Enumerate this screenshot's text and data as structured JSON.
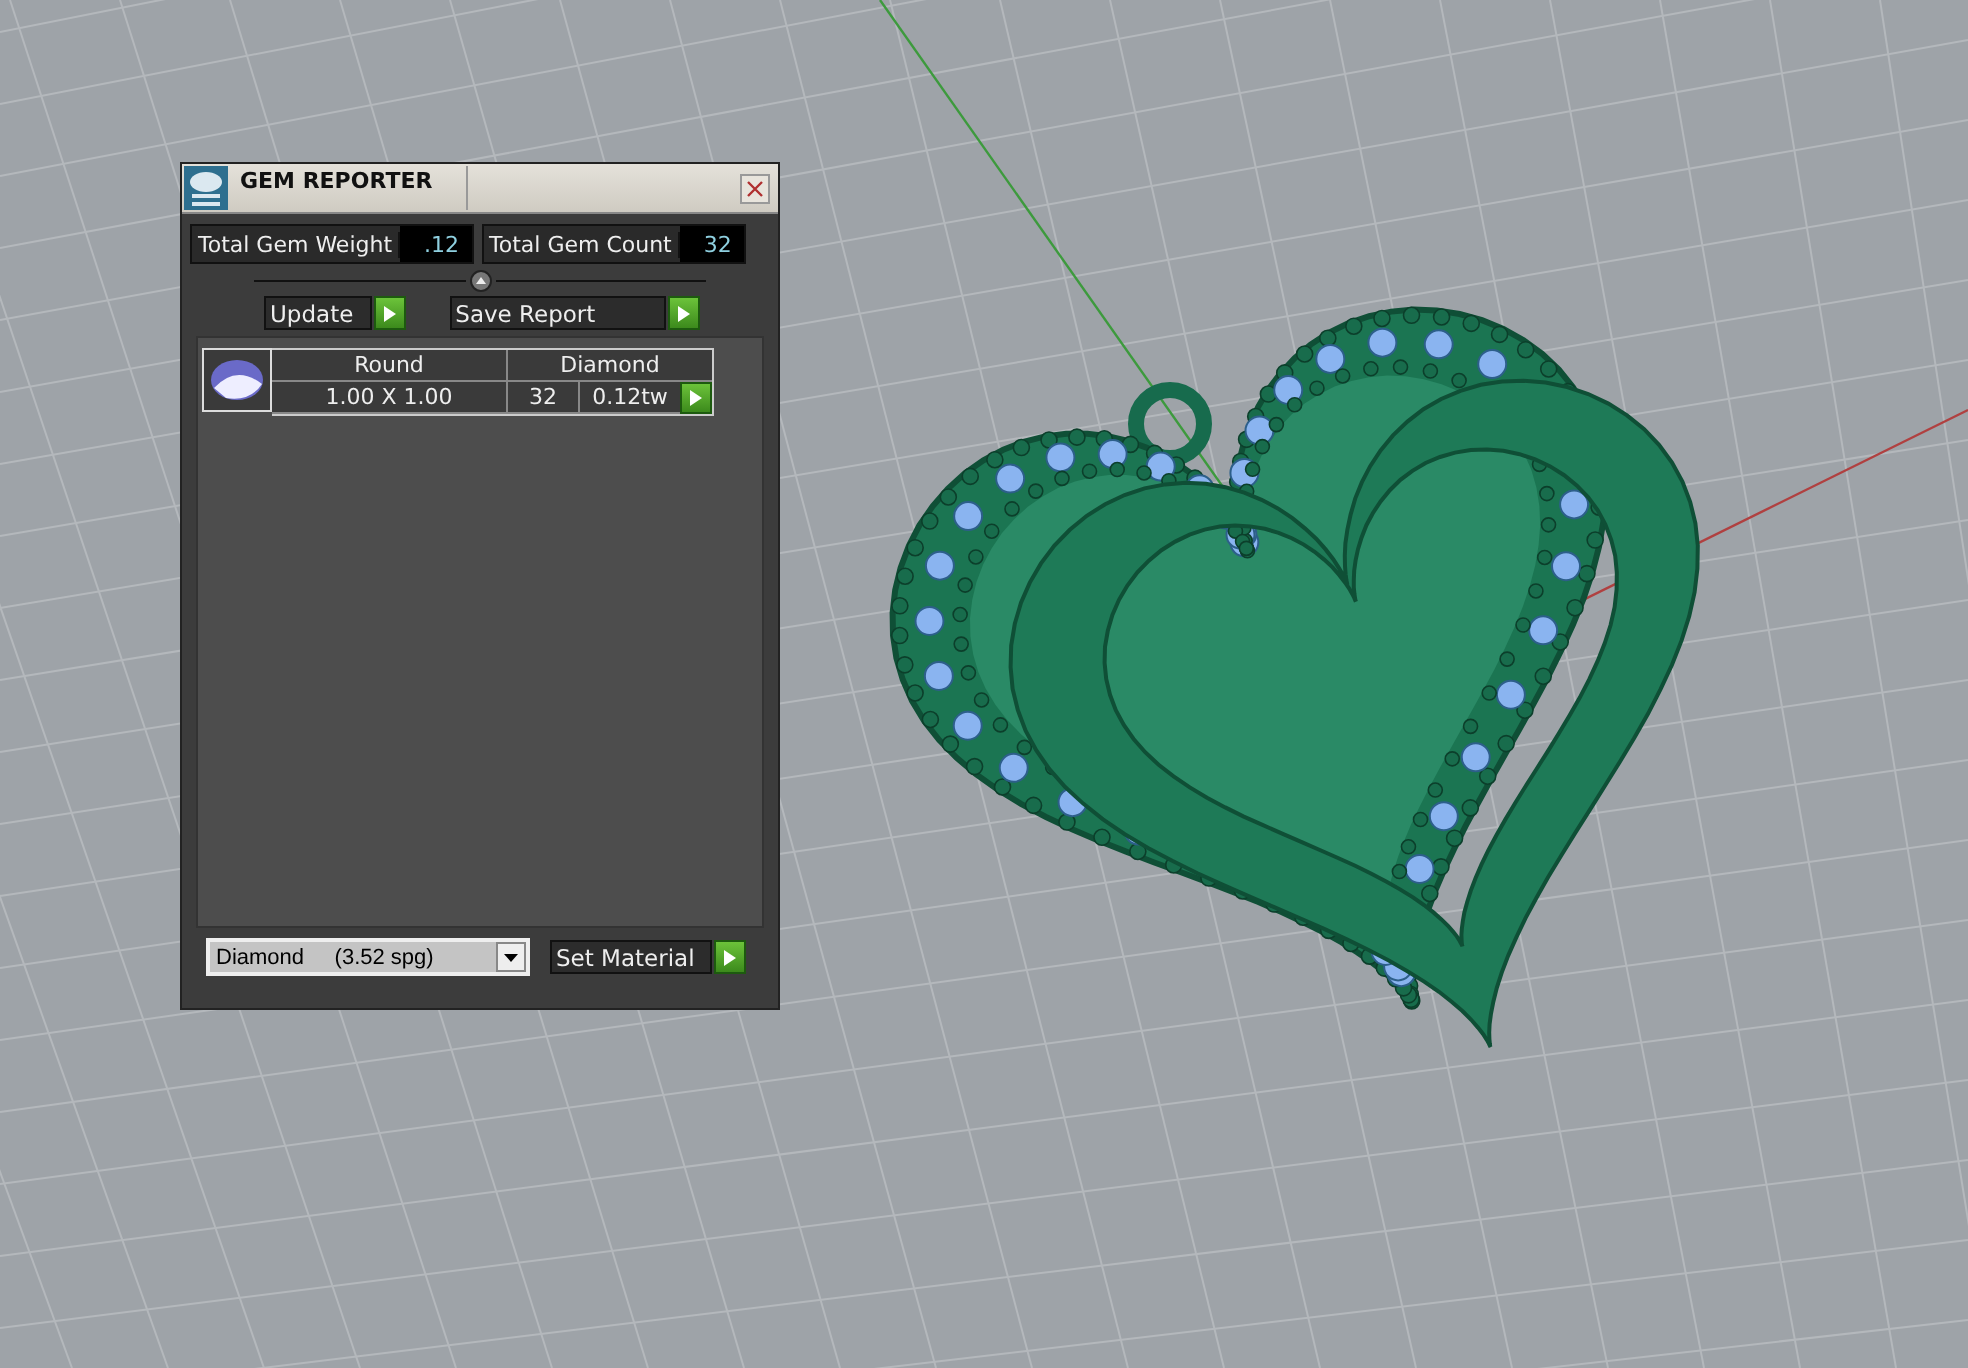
{
  "window": {
    "title": "GEM REPORTER"
  },
  "totals": [
    {
      "label": "Total Gem Weight",
      "value": ".12"
    },
    {
      "label": "Total Gem Count",
      "value": "32"
    }
  ],
  "buttons": [
    {
      "label": "Update"
    },
    {
      "label": "Save Report"
    }
  ],
  "gems": [
    {
      "shape": "Round",
      "material": "Diamond",
      "size": "1.00 X 1.00",
      "count": "32",
      "weight": "0.12tw"
    }
  ],
  "material_select": {
    "value": "Diamond     (3.52 spg)"
  },
  "set_button": {
    "label": "Set Material"
  }
}
